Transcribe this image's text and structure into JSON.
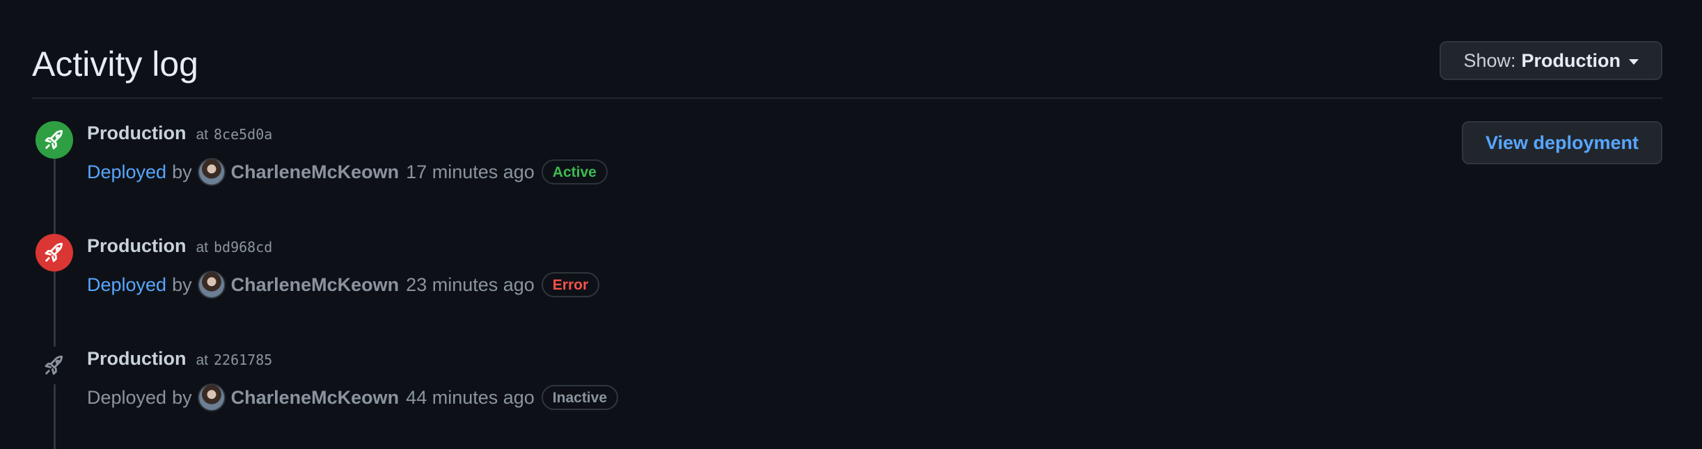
{
  "header": {
    "title": "Activity log",
    "show_label": "Show:",
    "show_value": "Production"
  },
  "entries": [
    {
      "environment": "Production",
      "at": "at",
      "sha": "8ce5d0a",
      "action": "Deployed",
      "by": "by",
      "user": "CharleneMcKeown",
      "time": "17 minutes ago",
      "status": "Active",
      "icon": "rocket-icon",
      "icon_bg": "#2ea043",
      "status_color": "#3fb950",
      "button": "View deployment"
    },
    {
      "environment": "Production",
      "at": "at",
      "sha": "bd968cd",
      "action": "Deployed",
      "by": "by",
      "user": "CharleneMcKeown",
      "time": "23 minutes ago",
      "status": "Error",
      "icon": "rocket-icon",
      "icon_bg": "#da3633",
      "status_color": "#f85149"
    },
    {
      "environment": "Production",
      "at": "at",
      "sha": "2261785",
      "action": "Deployed",
      "by": "by",
      "user": "CharleneMcKeown",
      "time": "44 minutes ago",
      "status": "Inactive",
      "icon": "rocket-icon",
      "status_color": "#8b949e"
    }
  ],
  "colors": {
    "background": "#0d1117",
    "link": "#58a6ff",
    "muted": "#8b949e"
  }
}
